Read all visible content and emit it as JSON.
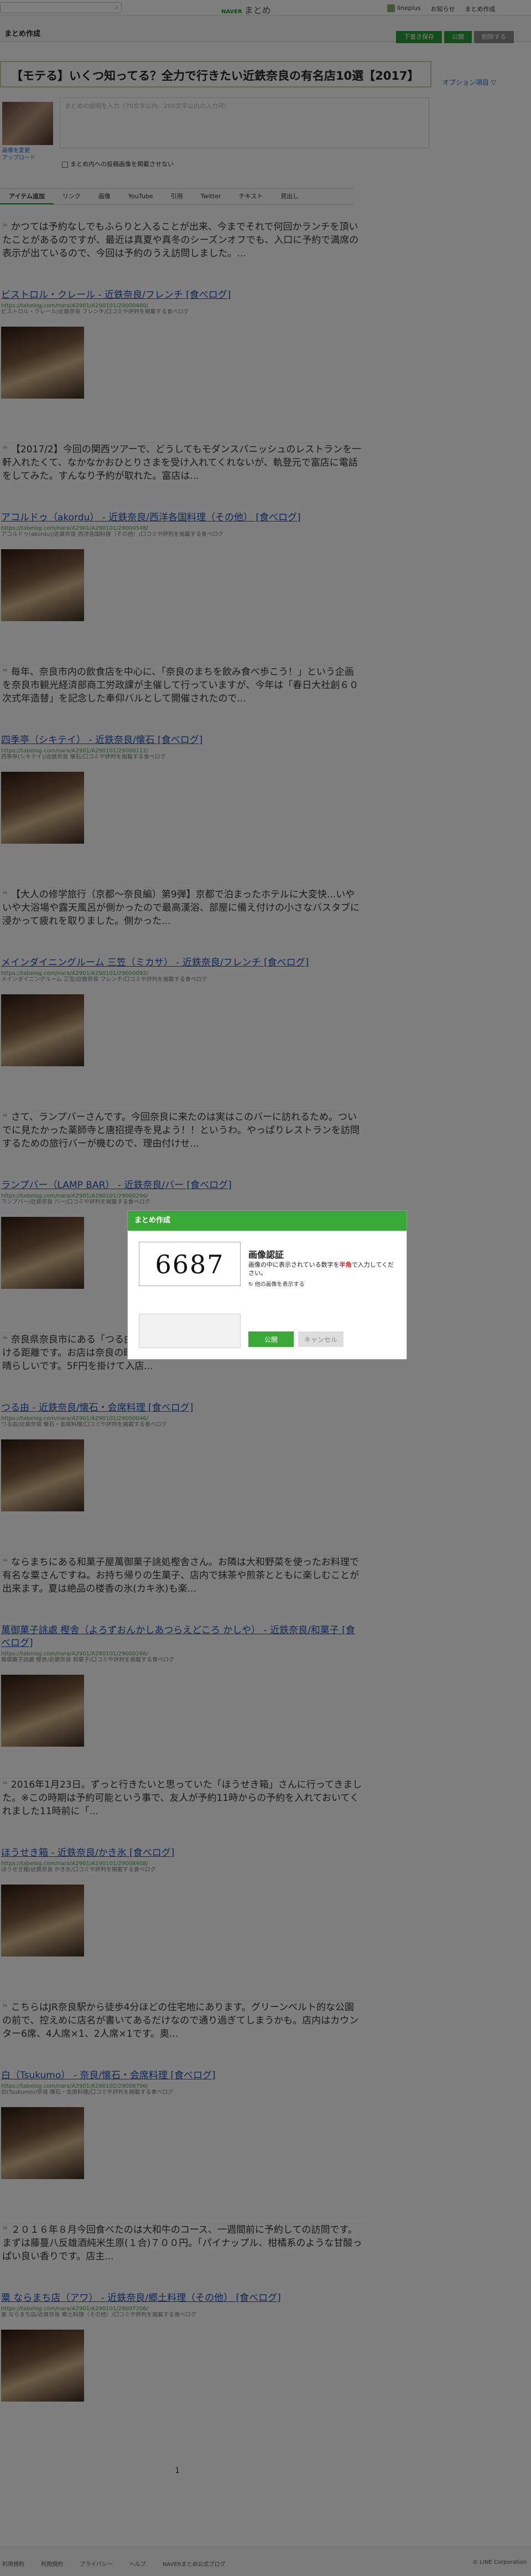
{
  "header": {
    "brand_small": "NAVER",
    "brand": "まとめ",
    "links": [
      "lineplus",
      "お知らせ",
      "まとめ作成"
    ]
  },
  "subbar": {
    "page_name": "まとめ作成",
    "buttons": [
      "下書き保存",
      "公開",
      "削除する"
    ]
  },
  "editor": {
    "title": "【モテる】いくつ知ってる？全力で行きたい近鉄奈良の有名店10選【2017】",
    "option_link": "オプション項目 ▽",
    "thumb_links": [
      "画像を変更",
      "アップロード"
    ],
    "desc_placeholder": "まとめの説明を入力（70文字以内、200文字以内の入力可）",
    "checkbox_label": "まとめ内への投稿画像を掲載させない"
  },
  "tabs": [
    "アイテム追加",
    "リンク",
    "画像",
    "YouTube",
    "引用",
    "Twitter",
    "テキスト",
    "見出し"
  ],
  "items": [
    {
      "quote": "かつては予約なしでもふらりと入ることが出来、今までそれで何回かランチを頂いたことがあるのですが、最近は真夏や真冬のシーズンオフでも、入口に予約で満席の表示が出ているので、今回は予約のうえ訪問しました。...",
      "link": "ビストロル・クレール - 近鉄奈良/フレンチ [食べログ]",
      "url": "https://tabelog.com/nara/A2901/A290101/29000480/",
      "snippet": "ビストロル・クレール/近鉄奈良 フレンチ/口コミや評判を掲載する食べログ"
    },
    {
      "quote": "【2017/2】今回の関西ツアーで、どうしてもモダンスパニッシュのレストランを一軒入れたくて、なかなかおひとりさまを受け入れてくれないが、軌登元で富店に電話をしてみた。すんなり予約が取れた。富店は...",
      "link": "アコルドゥ（akordu） - 近鉄奈良/西洋各国料理（その他） [食べログ]",
      "url": "https://tabelog.com/nara/A2901/A290101/29000548/",
      "snippet": "アコルドゥ(akordu)/近鉄奈良 西洋各国料理（その他）/口コミや評判を掲載する食べログ"
    },
    {
      "quote": "毎年、奈良市内の飲食店を中心に、「奈良のまちを飲み食べ歩こう！」という企画を奈良市観光経済部商工労政課が主催して行っていますが、今年は「春日大社創６０次式年造替」を記念した奉仰バルとして開催されたので...",
      "link": "四季亭（シキテイ） - 近鉄奈良/懐石 [食べログ]",
      "url": "https://tabelog.com/nara/A2901/A290101/29000112/",
      "snippet": "四季亭(シキテイ)/近鉄奈良 懐石/口コミや評判を掲載する食べログ"
    },
    {
      "quote": "【大人の修学旅行（京都〜奈良編）第9弾】京都で泊まったホテルに大変快...いやいや大浴場や露天風呂が側かったので最高漢浴、部屋に備え付けの小さなバスタブに浸かって疲れを取りました。側かった...",
      "link": "メインダイニングルーム 三笠（ミカサ） - 近鉄奈良/フレンチ [食べログ]",
      "url": "https://tabelog.com/nara/A2901/A290101/29000092/",
      "snippet": "メインダイニングルーム 三笠/近鉄奈良 フレンチ/口コミや評判を掲載する食べログ"
    },
    {
      "quote": "さて、ランプバーさんです。今回奈良に来たのは実はこのバーに訪れるため。ついでに見たかった薬師寺と唐招提寺を見よう！！というわ。やっぱりレストランを訪問するための旅行バーが機むので、理由付けせ...",
      "link": "ランプバー（LAMP BAR） - 近鉄奈良/バー [食べログ]",
      "url": "https://tabelog.com/nara/A2901/A290101/29000296/",
      "snippet": "ランプバー/近鉄奈良 バー/口コミや評判を掲載する食べログ"
    },
    {
      "quote": "奈良県奈良市にある「つる由」さんへ行ってきました。もJR奈良駅からも徒歩で行ける距離です。お店は奈良の町家を改装したお店です。照明の演出とお香の香りが素晴らしいです。5F円を掛けて入店...",
      "link": "つる由 - 近鉄奈良/懐石・会席料理 [食べログ]",
      "url": "https://tabelog.com/nara/A2901/A290101/29000046/",
      "snippet": "つる由/近鉄奈良 懐石・会席料理/口コミや評判を掲載する食べログ"
    },
    {
      "quote": "ならまちにある和菓子屋萬御菓子誂処樫舎さん。お隣は大和野菜を使ったお料理で有名な粟さんですね。お持ち帰りの生菓子、店内で抹茶や煎茶とともに楽しむことが出来ます。夏は絶品の楼香の氷(カキ氷)も楽...",
      "link": "萬御菓子誂處 樫舎（よろずおんかしあつらえどころ かしや） - 近鉄奈良/和菓子 [食べログ]",
      "url": "https://tabelog.com/nara/A2901/A290101/29000266/",
      "snippet": "萬御菓子誂處 樫舎/近鉄奈良 和菓子/口コミや評判を掲載する食べログ"
    },
    {
      "quote": "2016年1月23日。ずっと行きたいと思っていた「ほうせき箱」さんに行ってきました。※この時期は予約可能という事で、友人が予約11時からの予約を入れておいてくれました11時前に「...",
      "link": "ほうせき箱 - 近鉄奈良/かき氷 [食べログ]",
      "url": "https://tabelog.com/nara/A2901/A290101/29008408/",
      "snippet": "ほうせき箱/近鉄奈良 かき氷/口コミや評判を掲載する食べログ"
    },
    {
      "quote": "こちらはJR奈良駅から徒歩4分ほどの住宅地にあります。グリーンベルト的な公園の前で、控えめに店名が書いてあるだけなので通り過ぎてしまうかも。店内はカウンター6席、4人席×1、2人席×1です。奥...",
      "link": "白（Tsukumo） - 奈良/懐石・会席料理 [食べログ]",
      "url": "https://tabelog.com/nara/A2901/A290102/29008796/",
      "snippet": "白(Tsukumo)/奈良 懐石・会席料理/口コミや評判を掲載する食べログ"
    },
    {
      "quote": "２０１６年８月今回食べたのは大和牛のコース、一週間前に予約しての訪問です。まずは藤蔓八反雄酒純米生原(１合)７００円。「パイナップル、柑橘系のような甘酸っぱい良い香りです。店主...",
      "link": "粟 ならまち店（アワ） - 近鉄奈良/郷土料理（その他） [食べログ]",
      "url": "https://tabelog.com/nara/A2901/A290101/29007206/",
      "snippet": "粟 ならまち店/近鉄奈良 郷土料理（その他）/口コミや評判を掲載する食べログ"
    }
  ],
  "pagination": "1",
  "footer": {
    "links": [
      "利用規約",
      "利用規約",
      "プライバシー",
      "ヘルプ",
      "NAVERまとめ公式ブログ"
    ],
    "copyright": "© LINE Corporation"
  },
  "modal": {
    "header": "まとめ作成",
    "captcha_text": "6687",
    "title": "画像認証",
    "desc_before": "画像の中に表示されている数字を",
    "desc_red": "半角",
    "desc_after": "で入力してください。",
    "reload": "他の画像を表示する",
    "ok": "公開",
    "cancel": "キャンセル"
  }
}
